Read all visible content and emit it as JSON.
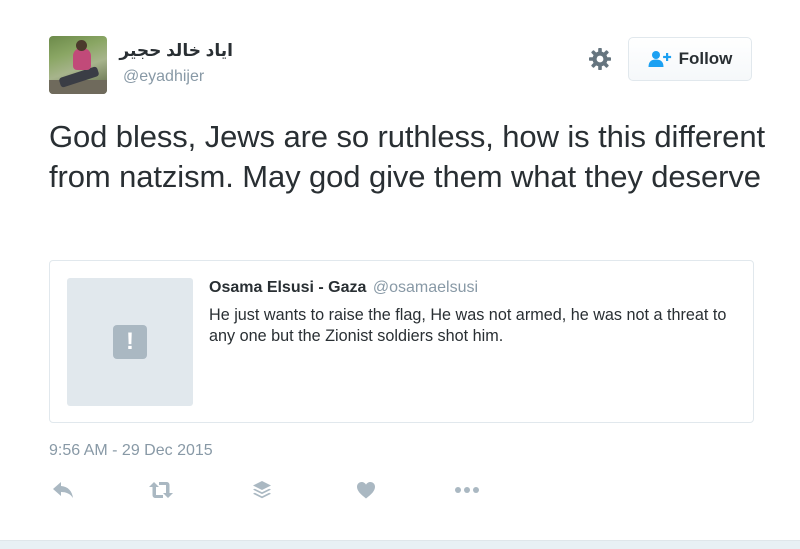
{
  "author": {
    "display_name": "اياد خالد حجير",
    "username": "@eyadhijer"
  },
  "header": {
    "follow_label": "Follow",
    "settings_icon": "gear-icon",
    "follow_icon": "add-user-icon"
  },
  "tweet": {
    "text": "God bless, Jews are so ruthless, how is this different from natzism. May god give them what they deserve",
    "timestamp": "9:56 AM - 29 Dec 2015"
  },
  "quote": {
    "name": "Osama Elsusi - Gaza",
    "username": "@osamaelsusi",
    "text": "He just wants to raise the flag, He was not armed, he was not a threat to any one but the Zionist soldiers shot him.",
    "media_icon_glyph": "!",
    "media_icon": "alert-icon"
  },
  "actions": [
    {
      "name": "reply-icon"
    },
    {
      "name": "retweet-icon"
    },
    {
      "name": "buffer-icon"
    },
    {
      "name": "like-icon"
    },
    {
      "name": "more-icon"
    }
  ],
  "colors": {
    "text": "#292f33",
    "muted": "#8899a6",
    "accent": "#1da1f2",
    "border": "#e1e8ed",
    "action_icon": "#aab8c2"
  }
}
